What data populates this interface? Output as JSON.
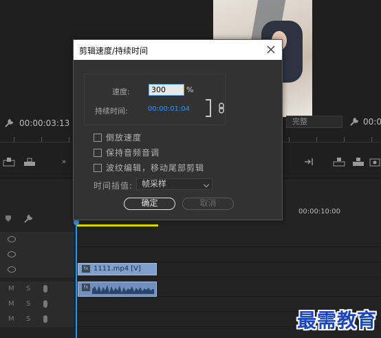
{
  "dialog": {
    "title": "剪辑速度/持续时间",
    "speed_label": "速度:",
    "speed_value": "300",
    "speed_unit": "%",
    "duration_label": "持续时间:",
    "duration_value": "00:00:01:04",
    "reverse_label": "倒放速度",
    "maintain_pitch_label": "保持音频音调",
    "ripple_label": "波纹编辑，移动尾部剪辑",
    "interp_label": "时间插值:",
    "interp_value": "帧采样",
    "ok_label": "确定",
    "cancel_label": "取消"
  },
  "source_monitor": {
    "timecode": "00:00:03:13"
  },
  "program_monitor": {
    "fit_value": "完整",
    "timecode": "00:00"
  },
  "timeline": {
    "time_label": "00:00:10:00",
    "tracks": [
      {
        "type": "video"
      },
      {
        "type": "video"
      },
      {
        "type": "video"
      },
      {
        "type": "audio",
        "m": "M",
        "s": "S"
      },
      {
        "type": "audio",
        "m": "M",
        "s": "S"
      },
      {
        "type": "audio",
        "m": "M",
        "s": "S"
      }
    ],
    "video_clip": {
      "name": "1111.mp4 [V]",
      "fx": "fx"
    },
    "audio_clip": {
      "fx": "fx"
    }
  },
  "watermark": "最需教育",
  "colors": {
    "accent": "#3f8fe6",
    "playhead": "#3a8fe0",
    "work_area": "#e5d300",
    "video_clip": "#7f9fcc",
    "audio_clip": "#6f8fbf"
  }
}
